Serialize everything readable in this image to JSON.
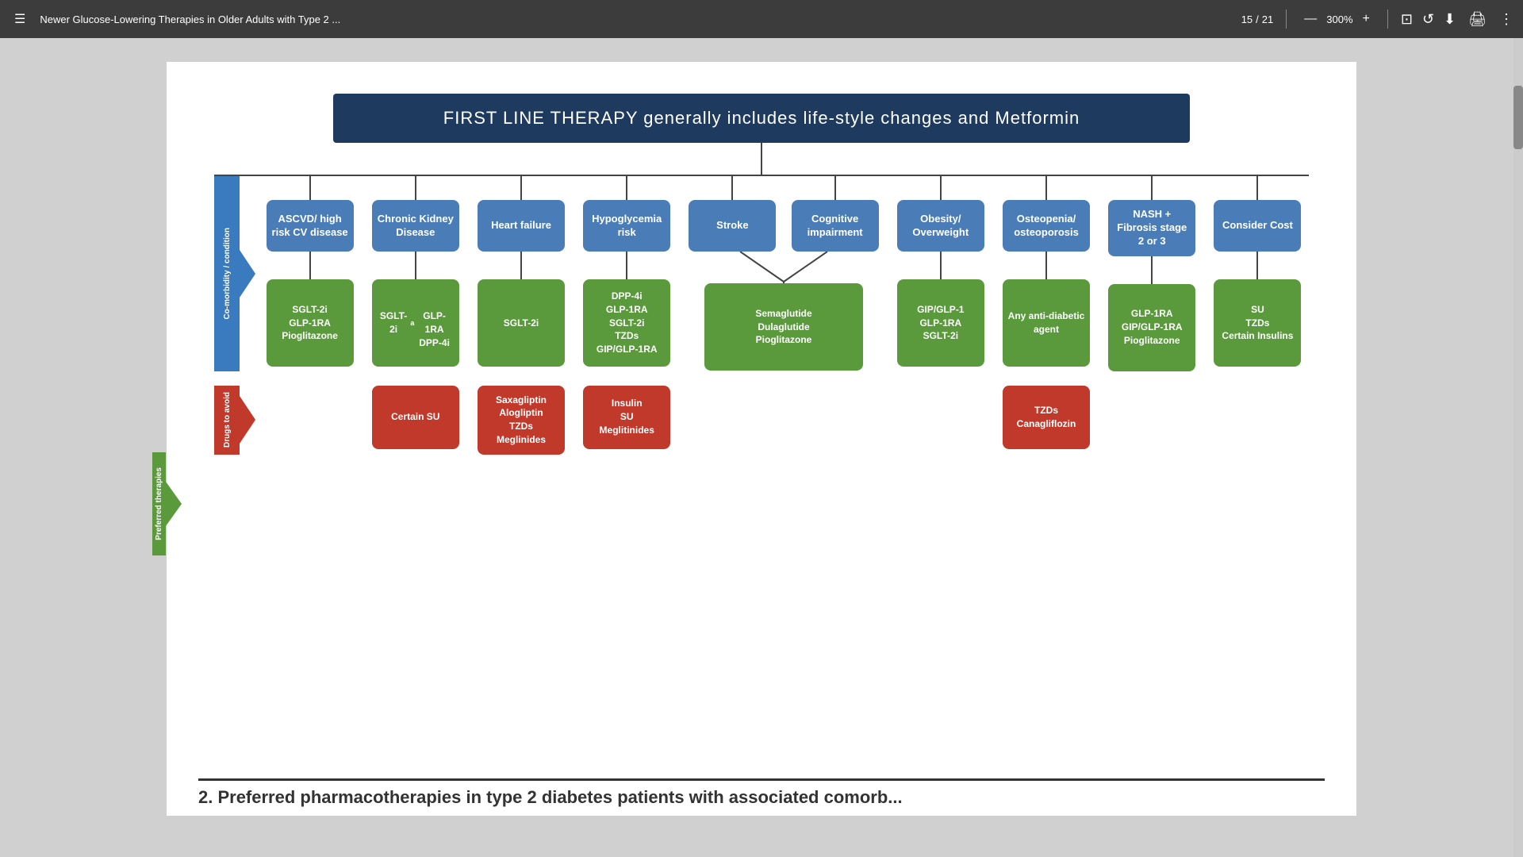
{
  "toolbar": {
    "menu_icon": "☰",
    "title": "Newer Glucose-Lowering Therapies in Older Adults with Type 2 ...",
    "page_current": "15",
    "page_total": "21",
    "zoom": "300%",
    "download_icon": "⬇",
    "print_icon": "🖨",
    "more_icon": "⋮"
  },
  "diagram": {
    "first_line_text": "FIRST LINE THERAPY  generally  includes  life-style  changes  and  Metformin",
    "left_labels": {
      "comorbidity": "Co-morbidity / condition",
      "preferred": "Preferred therapies",
      "avoid": "Drugs to avoid"
    },
    "conditions": [
      {
        "id": "ascvd",
        "label": "ASCVD/ high risk CV disease",
        "therapy": "SGLT-2i\nGLP-1RA\nPioglitazone",
        "avoid": null
      },
      {
        "id": "ckd",
        "label": "Chronic Kidney Disease",
        "therapy": "SGLT-2iᵃ\nGLP-1RA\nDPP-4i",
        "avoid": "Certain SU"
      },
      {
        "id": "heart-failure",
        "label": "Heart failure",
        "therapy": "SGLT-2i",
        "avoid": "Saxagliptin\nAlogliptin\nTZDs\nMeglinides"
      },
      {
        "id": "hypoglycemia",
        "label": "Hypoglycemia risk",
        "therapy": "DPP-4i\nGLP-1RA\nSGLT-2i\nTZDs\nGIP/GLP-1RA",
        "avoid": "Insulin\nSU\nMeglitinides"
      },
      {
        "id": "stroke",
        "label": "Stroke",
        "therapy": "Semaglutide\nDulaglutide\nPioglitazone",
        "avoid": null,
        "merged_with": "cognitive"
      },
      {
        "id": "cognitive",
        "label": "Cognitive impairment",
        "therapy": null,
        "avoid": null,
        "merged_with": "stroke"
      },
      {
        "id": "obesity",
        "label": "Obesity/ Overweight",
        "therapy": "GIP/GLP-1\nGLP-1RA\nSGLT-2i",
        "avoid": null
      },
      {
        "id": "osteopenia",
        "label": "Osteopenia/ osteoporosis",
        "therapy": "Any anti-diabetic agent",
        "avoid": "TZDs\nCanagliflozin"
      },
      {
        "id": "nash",
        "label": "NASH + Fibrosis stage 2 or 3",
        "therapy": "GLP-1RA\nGIP/GLP-1RA\nPioglitazone",
        "avoid": null
      },
      {
        "id": "cost",
        "label": "Consider Cost",
        "therapy": "SU\nTZDs\nCertain Insulins",
        "avoid": null
      }
    ]
  },
  "bottom_text": "2.  Preferred pharmacotherapies in type 2 diabetes patients with associated comorb..."
}
